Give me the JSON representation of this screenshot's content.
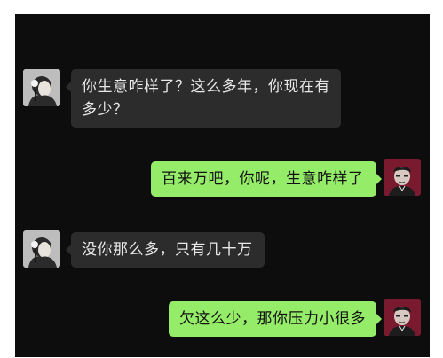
{
  "chat": {
    "messages": [
      {
        "sender": "other",
        "avatar": "girl-avatar",
        "text": "你生意咋样了？这么多年，你现在有多少？"
      },
      {
        "sender": "self",
        "avatar": "boy-avatar",
        "text": "百来万吧，你呢，生意咋样了"
      },
      {
        "sender": "other",
        "avatar": "girl-avatar",
        "text": "没你那么多，只有几十万"
      },
      {
        "sender": "self",
        "avatar": "boy-avatar",
        "text": "欠这么少，那你压力小很多"
      }
    ]
  },
  "colors": {
    "background": "#0d0d0d",
    "bubble_other": "#2c2c2c",
    "bubble_self": "#95ec69",
    "avatar_self_bg": "#7a1a2e"
  }
}
